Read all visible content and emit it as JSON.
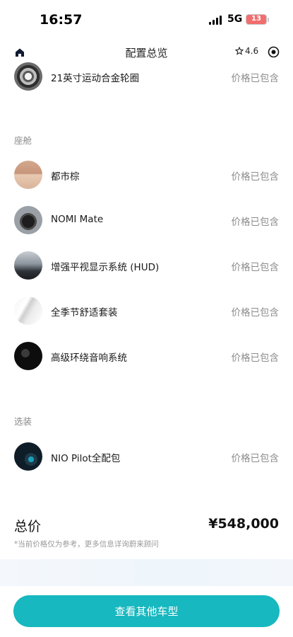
{
  "status_bar": {
    "time": "16:57",
    "network": "5G",
    "battery": "13",
    "battery_level_percent": 13,
    "battery_color": "#f26d6d"
  },
  "nav": {
    "title": "配置总览",
    "rating": "4.6",
    "icons": [
      "home-icon",
      "star-icon",
      "target-icon"
    ]
  },
  "top_item": {
    "label": "21英寸运动合金轮圈",
    "value": "价格已包含",
    "icon": "wheel-thumbnail"
  },
  "cabin": {
    "title": "座舱",
    "items": [
      {
        "label": "都市棕",
        "value": "价格已包含"
      },
      {
        "label": "NOMI Mate",
        "value": "价格已包含"
      },
      {
        "label": "增强平视显示系统 (HUD)",
        "value": "价格已包含"
      },
      {
        "label": "全季节舒适套装",
        "value": "价格已包含"
      },
      {
        "label": "高级环绕音响系统",
        "value": "价格已包含"
      }
    ]
  },
  "options": {
    "title": "选装",
    "items": [
      {
        "label": "NIO Pilot全配包",
        "value": "价格已包含"
      }
    ]
  },
  "total": {
    "label": "总价",
    "value": "¥548,000",
    "note": "*当前价格仅为参考，更多信息详询蔚来顾问"
  },
  "cta": {
    "label": "查看其他车型",
    "color": "#17b8bf"
  }
}
